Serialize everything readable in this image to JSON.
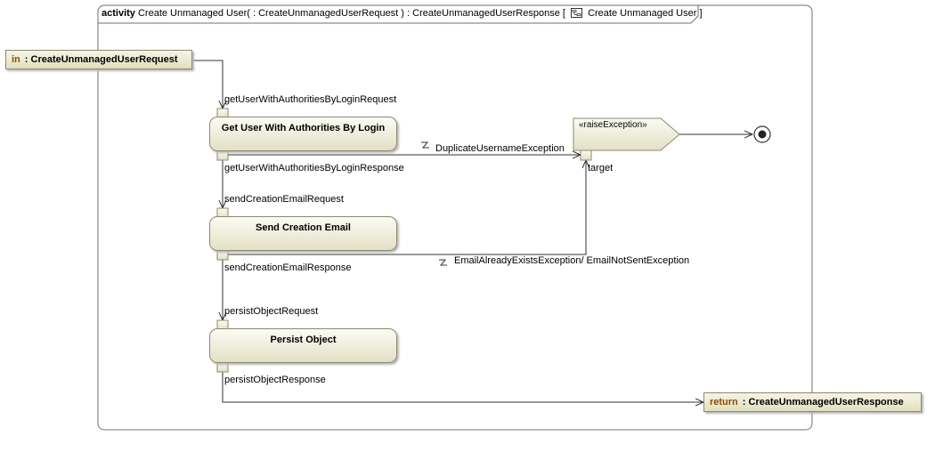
{
  "frame": {
    "keyword": "activity",
    "signature": "Create Unmanaged User( : CreateUnmanagedUserRequest ) : CreateUnmanagedUserResponse [",
    "diagram_name": "Create Unmanaged User",
    "close_bracket": "]"
  },
  "params": {
    "input": {
      "direction": "in",
      "type": ": CreateUnmanagedUserRequest"
    },
    "output": {
      "direction": "return",
      "type": ": CreateUnmanagedUserResponse"
    }
  },
  "actions": {
    "get_user": "Get User With Authorities By Login",
    "send_email": "Send Creation Email",
    "persist": "Persist Object"
  },
  "pins": {
    "get_user_in": "getUserWithAuthoritiesByLoginRequest",
    "get_user_out": "getUserWithAuthoritiesByLoginResponse",
    "send_email_in": "sendCreationEmailRequest",
    "send_email_out": "sendCreationEmailResponse",
    "persist_in": "persistObjectRequest",
    "persist_out": "persistObjectResponse",
    "raise_target": "target"
  },
  "raise_exception": {
    "stereotype": "«raiseException»"
  },
  "exceptions": {
    "duplicate": "DuplicateUsernameException",
    "email": "EmailAlreadyExistsException/ EmailNotSentException"
  },
  "colors": {
    "node_fill": "#ece9d0",
    "node_border": "#8c8a6e",
    "line": "#333333",
    "keyword": "#8a4b00"
  }
}
